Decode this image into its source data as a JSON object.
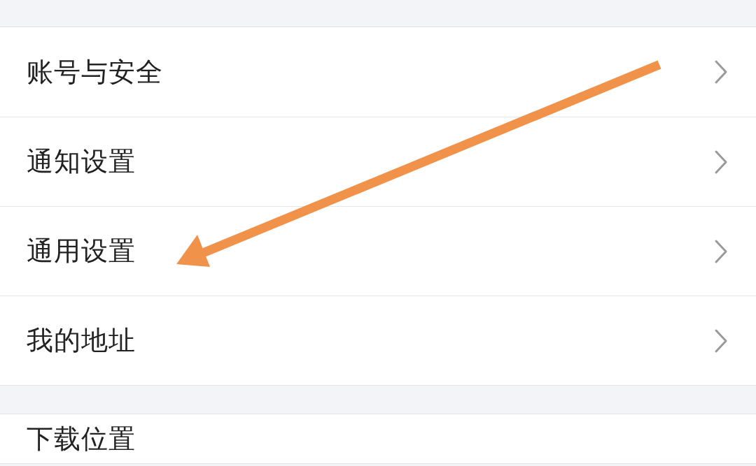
{
  "sections": [
    {
      "items": [
        {
          "label": "账号与安全"
        },
        {
          "label": "通知设置"
        },
        {
          "label": "通用设置"
        },
        {
          "label": "我的地址"
        }
      ]
    },
    {
      "items": [
        {
          "label": "下载位置"
        }
      ]
    }
  ],
  "annotation": {
    "kind": "arrow"
  }
}
